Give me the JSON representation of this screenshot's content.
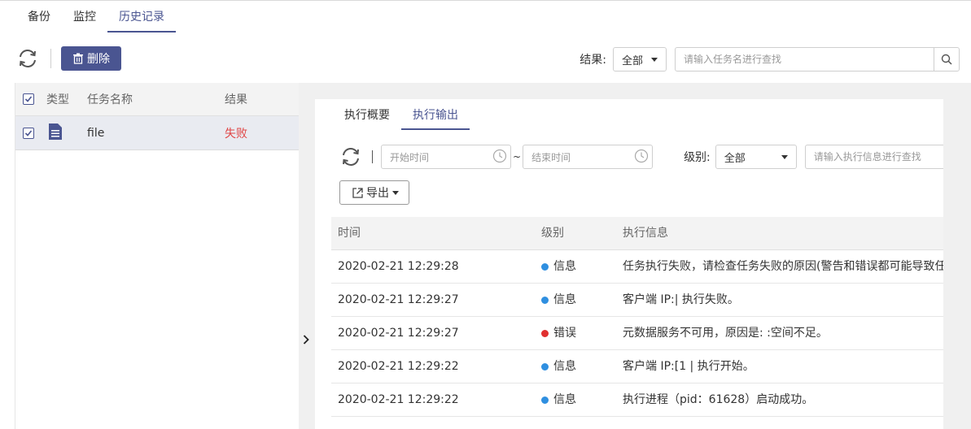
{
  "top_tabs": [
    "备份",
    "监控",
    "历史记录"
  ],
  "toolbar": {
    "delete_label": "删除"
  },
  "filter": {
    "result_label": "结果:",
    "result_value": "全部",
    "search_placeholder": "请输入任务名进行查找"
  },
  "task_table": {
    "headers": {
      "type": "类型",
      "name": "任务名称",
      "result": "结果"
    },
    "rows": [
      {
        "name": "file",
        "result": "失败"
      }
    ]
  },
  "detail": {
    "tabs": [
      "执行概要",
      "执行输出"
    ],
    "start_placeholder": "开始时间",
    "end_placeholder": "结束时间",
    "tilde": "~",
    "level_label": "级别:",
    "level_value": "全部",
    "search_placeholder": "请输入执行信息进行查找",
    "export_label": "导出",
    "log_headers": {
      "time": "时间",
      "level": "级别",
      "message": "执行信息"
    },
    "logs": [
      {
        "time": "2020-02-21 12:29:28",
        "level": "信息",
        "message": "任务执行失败，请检查任务失败的原因(警告和错误都可能导致任"
      },
      {
        "time": "2020-02-21 12:29:27",
        "level": "信息",
        "message": "客户端 IP:|                    执行失败。"
      },
      {
        "time": "2020-02-21 12:29:27",
        "level": "错误",
        "message": "元数据服务不可用，原因是:                                 :空间不足。"
      },
      {
        "time": "2020-02-21 12:29:22",
        "level": "信息",
        "message": "客户端 IP:[1                 | 执行开始。"
      },
      {
        "time": "2020-02-21 12:29:22",
        "level": "信息",
        "message": "执行进程（pid：61628）启动成功。"
      }
    ]
  },
  "colors": {
    "accent": "#4a5591",
    "info": "#2f8fe0",
    "error": "#e03030",
    "fail": "#e04545"
  }
}
